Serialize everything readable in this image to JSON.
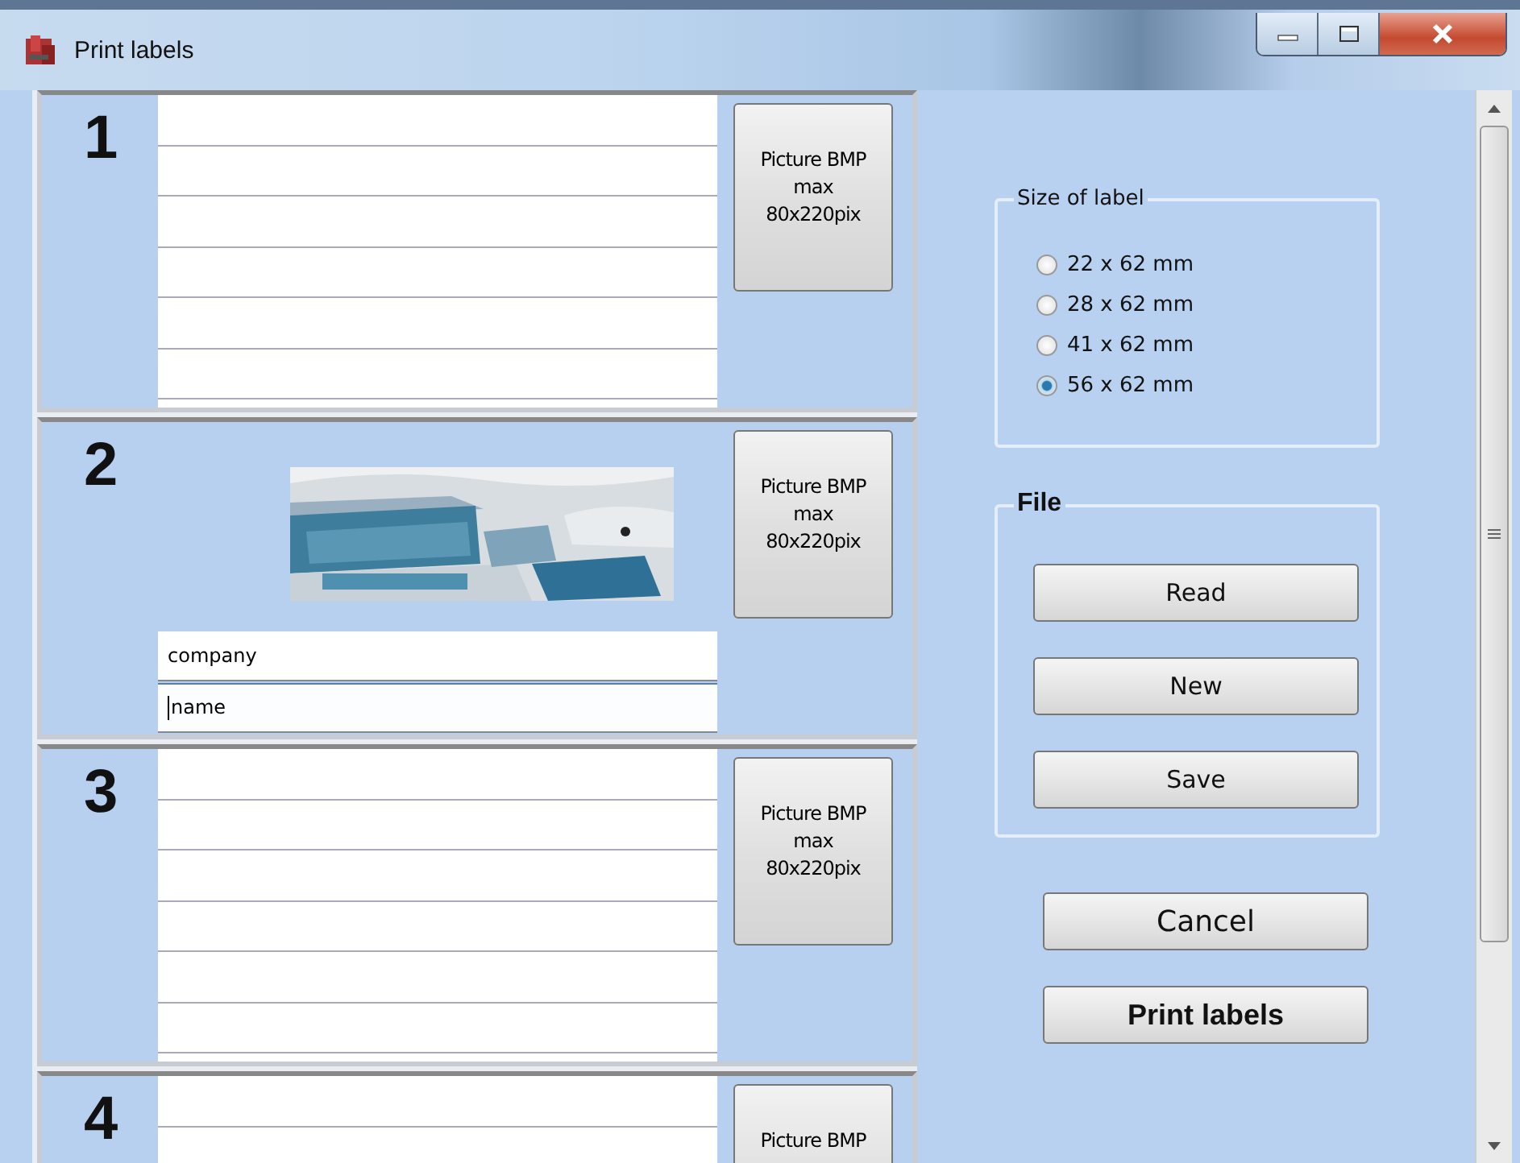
{
  "window": {
    "title": "Print labels"
  },
  "labels": [
    {
      "number": "1",
      "kind": "blank",
      "button": [
        "Picture BMP",
        "max",
        "80x220pix"
      ]
    },
    {
      "number": "2",
      "kind": "picture",
      "lines": [
        {
          "value": "company",
          "focused": false
        },
        {
          "value": "name",
          "focused": true
        }
      ],
      "button": [
        "Picture BMP",
        "max",
        "80x220pix"
      ]
    },
    {
      "number": "3",
      "kind": "blank",
      "button": [
        "Picture BMP",
        "max",
        "80x220pix"
      ]
    },
    {
      "number": "4",
      "kind": "blank",
      "button": [
        "Picture BMP"
      ]
    }
  ],
  "size_group": {
    "title": "Size of label",
    "options": [
      {
        "label": "22 x 62 mm",
        "selected": false
      },
      {
        "label": "28 x 62 mm",
        "selected": false
      },
      {
        "label": "41 x 62 mm",
        "selected": false
      },
      {
        "label": "56 x 62 mm",
        "selected": true
      }
    ]
  },
  "file_group": {
    "title": "File",
    "buttons": [
      "Read",
      "New",
      "Save"
    ]
  },
  "actions": [
    {
      "label": "Cancel",
      "kind": "normal"
    },
    {
      "label": "Print labels",
      "kind": "bold"
    }
  ]
}
